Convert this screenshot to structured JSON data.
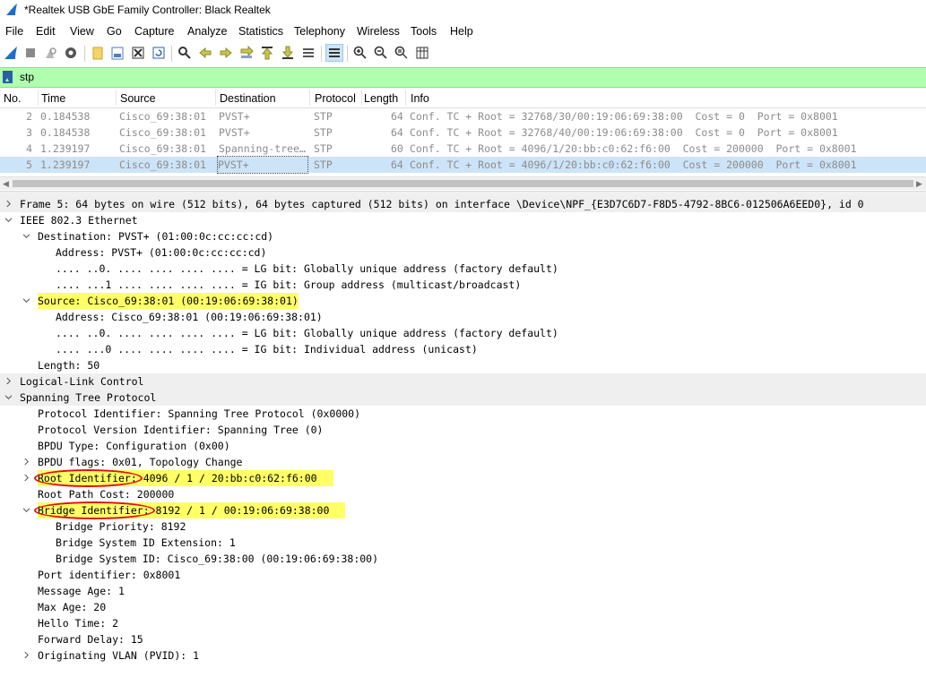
{
  "window": {
    "title": "*Realtek USB GbE Family Controller: Black Realtek"
  },
  "menu": [
    "File",
    "Edit",
    "View",
    "Go",
    "Capture",
    "Analyze",
    "Statistics",
    "Telephony",
    "Wireless",
    "Tools",
    "Help"
  ],
  "toolbar_icons": [
    "shark-fin-icon",
    "stop-icon",
    "restart-icon",
    "options-gear-icon",
    "open-file-icon",
    "save-file-icon",
    "close-file-icon",
    "reload-icon",
    "find-icon",
    "back-arrow-icon",
    "forward-arrow-icon",
    "goto-packet-icon",
    "first-packet-icon",
    "last-packet-icon",
    "autoscroll-icon",
    "colorize-icon",
    "zoom-in-icon",
    "zoom-out-icon",
    "zoom-normal-icon",
    "resize-columns-icon"
  ],
  "filter": {
    "value": "stp"
  },
  "columns": {
    "no": "No.",
    "time": "Time",
    "source": "Source",
    "destination": "Destination",
    "protocol": "Protocol",
    "length": "Length",
    "info": "Info"
  },
  "packets": [
    {
      "no": "2",
      "time": "0.184538",
      "source": "Cisco_69:38:01",
      "destination": "PVST+",
      "protocol": "STP",
      "length": "64",
      "info": "Conf. TC + Root = 32768/30/00:19:06:69:38:00  Cost = 0  Port = 0x8001"
    },
    {
      "no": "3",
      "time": "0.184538",
      "source": "Cisco_69:38:01",
      "destination": "PVST+",
      "protocol": "STP",
      "length": "64",
      "info": "Conf. TC + Root = 32768/40/00:19:06:69:38:00  Cost = 0  Port = 0x8001"
    },
    {
      "no": "4",
      "time": "1.239197",
      "source": "Cisco_69:38:01",
      "destination": "Spanning-tree…",
      "protocol": "STP",
      "length": "60",
      "info": "Conf. TC + Root = 4096/1/20:bb:c0:62:f6:00  Cost = 200000  Port = 0x8001"
    },
    {
      "no": "5",
      "time": "1.239197",
      "source": "Cisco_69:38:01",
      "destination": "PVST+",
      "protocol": "STP",
      "length": "64",
      "info": "Conf. TC + Root = 4096/1/20:bb:c0:62:f6:00  Cost = 200000  Port = 0x8001"
    }
  ],
  "details": [
    {
      "text": "Frame 5: 64 bytes on wire (512 bits), 64 bytes captured (512 bits) on interface \\Device\\NPF_{E3D7C6D7-F8D5-4792-8BC6-012506A6EED0}, id 0",
      "level": 0,
      "state": "collapsed",
      "bg": true
    },
    {
      "text": "IEEE 802.3 Ethernet",
      "level": 0,
      "state": "expanded",
      "bg": false
    },
    {
      "text": "Destination: PVST+ (01:00:0c:cc:cc:cd)",
      "level": 1,
      "state": "expanded"
    },
    {
      "text": "Address: PVST+ (01:00:0c:cc:cc:cd)",
      "level": 2
    },
    {
      "text": ".... ..0. .... .... .... .... = LG bit: Globally unique address (factory default)",
      "level": 2
    },
    {
      "text": ".... ...1 .... .... .... .... = IG bit: Group address (multicast/broadcast)",
      "level": 2
    },
    {
      "text": "Source: Cisco_69:38:01 (00:19:06:69:38:01)",
      "level": 1,
      "state": "expanded",
      "highlight": true
    },
    {
      "text": "Address: Cisco_69:38:01 (00:19:06:69:38:01)",
      "level": 2
    },
    {
      "text": ".... ..0. .... .... .... .... = LG bit: Globally unique address (factory default)",
      "level": 2
    },
    {
      "text": ".... ...0 .... .... .... .... = IG bit: Individual address (unicast)",
      "level": 2
    },
    {
      "text": "Length: 50",
      "level": 1
    },
    {
      "text": "Logical-Link Control",
      "level": 0,
      "state": "collapsed",
      "bg": true
    },
    {
      "text": "Spanning Tree Protocol",
      "level": 0,
      "state": "expanded",
      "bg": true
    },
    {
      "text": "Protocol Identifier: Spanning Tree Protocol (0x0000)",
      "level": 1
    },
    {
      "text": "Protocol Version Identifier: Spanning Tree (0)",
      "level": 1
    },
    {
      "text": "BPDU Type: Configuration (0x00)",
      "level": 1
    },
    {
      "text": "BPDU flags: 0x01, Topology Change",
      "level": 1,
      "state": "collapsed"
    },
    {
      "text": "Root Identifier: 4096 / 1 / 20:bb:c0:62:f6:00",
      "level": 1,
      "state": "collapsed",
      "highlight": true,
      "circled": "Root Identifier:"
    },
    {
      "text": "Root Path Cost: 200000",
      "level": 1
    },
    {
      "text": "Bridge Identifier: 8192 / 1 / 00:19:06:69:38:00",
      "level": 1,
      "state": "expanded",
      "highlight": true,
      "circled": "Bridge Identifier:"
    },
    {
      "text": "Bridge Priority: 8192",
      "level": 2
    },
    {
      "text": "Bridge System ID Extension: 1",
      "level": 2
    },
    {
      "text": "Bridge System ID: Cisco_69:38:00 (00:19:06:69:38:00)",
      "level": 2
    },
    {
      "text": "Port identifier: 0x8001",
      "level": 1
    },
    {
      "text": "Message Age: 1",
      "level": 1
    },
    {
      "text": "Max Age: 20",
      "level": 1
    },
    {
      "text": "Hello Time: 2",
      "level": 1
    },
    {
      "text": "Forward Delay: 15",
      "level": 1
    },
    {
      "text": "Originating VLAN (PVID): 1",
      "level": 1,
      "state": "collapsed"
    }
  ],
  "colors": {
    "filter_bg": "#afffaf",
    "selected_row": "#cce4f7",
    "highlight": "#ffff66",
    "annotation": "#e01010"
  }
}
